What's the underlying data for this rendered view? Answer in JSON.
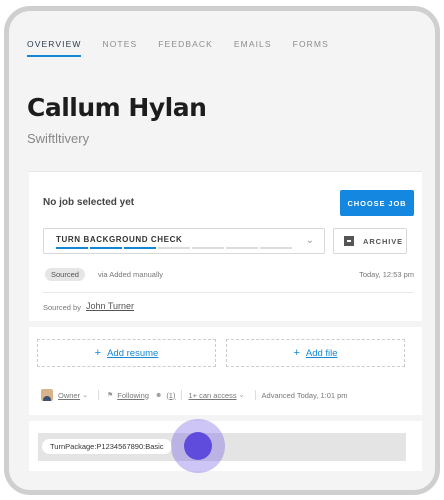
{
  "tabs": [
    {
      "label": "OVERVIEW",
      "active": true
    },
    {
      "label": "NOTES"
    },
    {
      "label": "FEEDBACK"
    },
    {
      "label": "EMAILS"
    },
    {
      "label": "FORMS"
    }
  ],
  "candidate": {
    "name": "Callum Hylan",
    "company": "Swiftltivery"
  },
  "job": {
    "no_job_text": "No job selected yet",
    "choose_button": "CHOOSE JOB",
    "stage_label": "TURN BACKGROUND CHECK",
    "stage_segments_total": 7,
    "stage_segments_done": 3,
    "archive_button": "ARCHIVE",
    "source_badge": "Sourced",
    "source_via": "via Added manually",
    "timestamp": "Today, 12:53 pm",
    "sourced_by_label": "Sourced by",
    "sourced_by_name": "John Turner"
  },
  "attachments": {
    "add_resume": "Add resume",
    "add_file": "Add file",
    "plus": "+"
  },
  "meta": {
    "owner": "Owner",
    "following": "Following",
    "followers": "(1)",
    "access": "1+ can access",
    "advanced": "Advanced Today, 1:01 pm"
  },
  "package": {
    "chip": "TurnPackage:P1234567890:Basic"
  },
  "colors": {
    "accent": "#1487d4",
    "touch": "#5f4bdc"
  },
  "icons": [
    "chevron-down-icon",
    "archive-box-icon",
    "plus-icon",
    "avatar-icon",
    "bell-icon",
    "people-icon"
  ]
}
